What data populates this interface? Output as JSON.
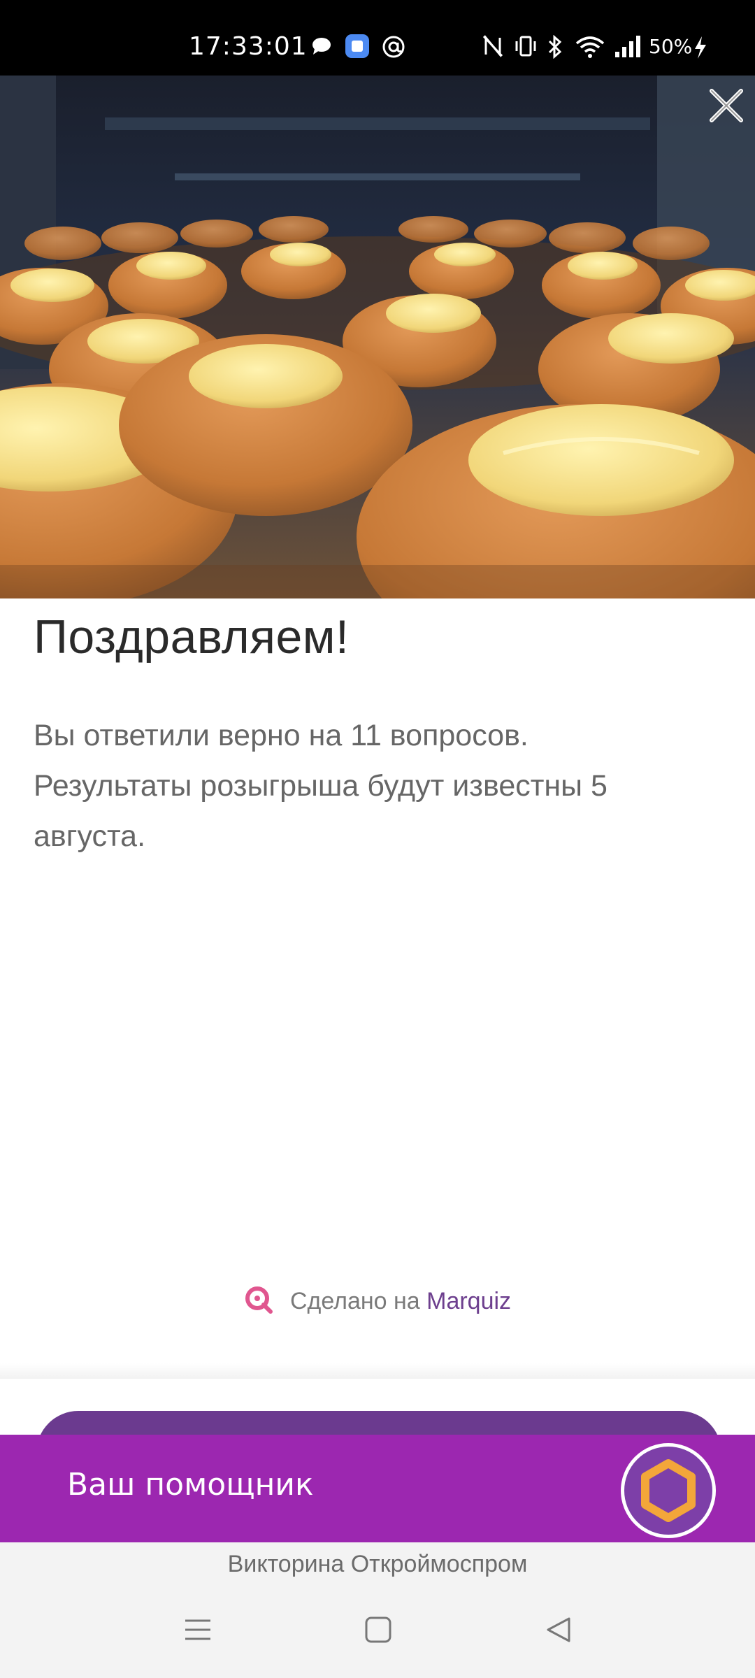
{
  "status_bar": {
    "time": "17:33:01",
    "battery": "50%",
    "icons": [
      "chat-bubble-icon",
      "app-icon",
      "at-sign-icon",
      "nfc-icon",
      "vibrate-icon",
      "bluetooth-icon",
      "wifi-icon",
      "signal-icon",
      "battery-charging-icon"
    ]
  },
  "hero": {
    "image": "chocolate-candies-photo",
    "close_icon": "close-icon"
  },
  "content": {
    "title": "Поздравляем!",
    "line1": "Вы ответили верно на 11 вопросов.",
    "line2": "Результаты розыгрыша будут известны 5",
    "line3": "августа."
  },
  "made_with": {
    "prefix": "Сделано на ",
    "brand": "Marquiz"
  },
  "assistant": {
    "label": "Ваш помощник",
    "avatar_icon": "hexagon-icon"
  },
  "footer": {
    "label": "Викторина Откроймоспром"
  },
  "nav": {
    "items": [
      "menu-icon",
      "home-icon",
      "back-icon"
    ]
  },
  "colors": {
    "accent_purple": "#9c27b0",
    "dark_purple": "#6b3a8f",
    "brand_text": "#6d3f8e",
    "logo_pink": "#e0568f",
    "hex_orange": "#f3a63a"
  }
}
